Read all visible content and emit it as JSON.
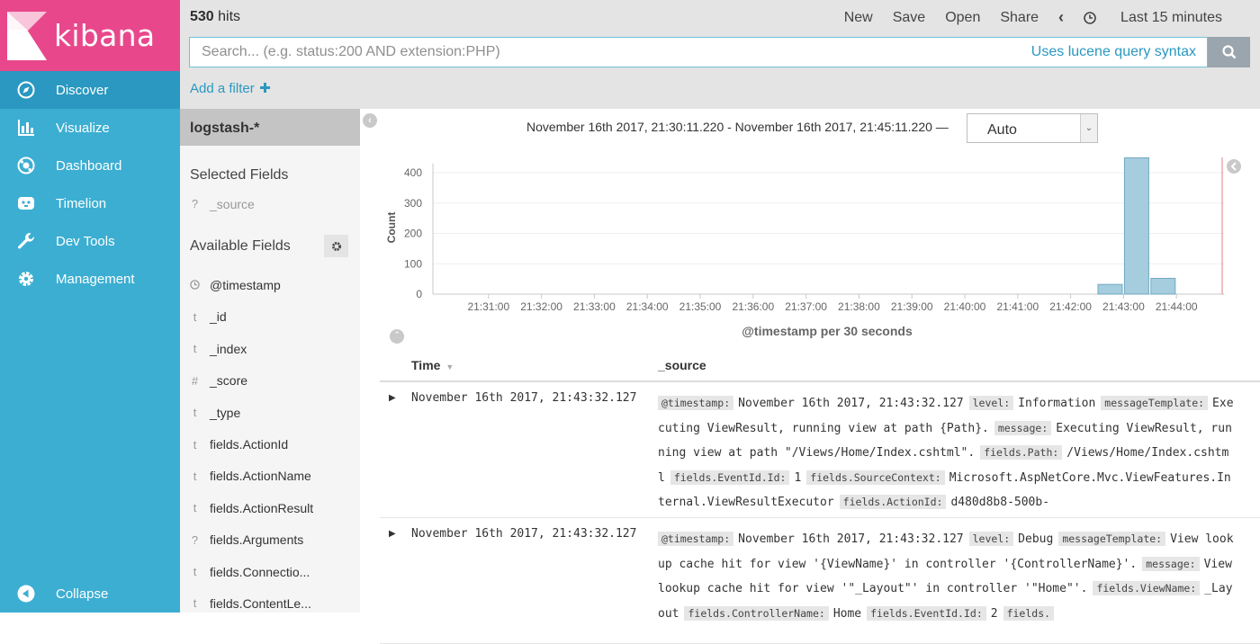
{
  "app": {
    "name": "kibana"
  },
  "nav": {
    "items": [
      {
        "label": "Discover",
        "icon": "compass-icon",
        "active": true
      },
      {
        "label": "Visualize",
        "icon": "bar-chart-icon"
      },
      {
        "label": "Dashboard",
        "icon": "dashboard-icon"
      },
      {
        "label": "Timelion",
        "icon": "timelion-icon"
      },
      {
        "label": "Dev Tools",
        "icon": "wrench-icon"
      },
      {
        "label": "Management",
        "icon": "gear-icon"
      }
    ],
    "collapse": "Collapse"
  },
  "topbar": {
    "hits_count": "530",
    "hits_label": "hits",
    "menu": {
      "new": "New",
      "save": "Save",
      "open": "Open",
      "share": "Share",
      "time": "Last 15 minutes"
    },
    "search": {
      "placeholder": "Search... (e.g. status:200 AND extension:PHP)",
      "hint": "Uses lucene query syntax"
    },
    "add_filter": "Add a filter"
  },
  "sidebar": {
    "index_pattern": "logstash-*",
    "selected_heading": "Selected Fields",
    "selected_fields": [
      {
        "type": "?",
        "name": "_source"
      }
    ],
    "available_heading": "Available Fields",
    "available_fields": [
      {
        "type": "clock",
        "name": "@timestamp"
      },
      {
        "type": "t",
        "name": "_id"
      },
      {
        "type": "t",
        "name": "_index"
      },
      {
        "type": "#",
        "name": "_score"
      },
      {
        "type": "t",
        "name": "_type"
      },
      {
        "type": "t",
        "name": "fields.ActionId"
      },
      {
        "type": "t",
        "name": "fields.ActionName"
      },
      {
        "type": "t",
        "name": "fields.ActionResult"
      },
      {
        "type": "?",
        "name": "fields.Arguments"
      },
      {
        "type": "t",
        "name": "fields.Connectio..."
      },
      {
        "type": "t",
        "name": "fields.ContentLe..."
      }
    ]
  },
  "histogram": {
    "range_text": "November 16th 2017, 21:30:11.220 - November 16th 2017, 21:45:11.220 —",
    "interval": "Auto"
  },
  "chart_data": {
    "type": "bar",
    "ylabel": "Count",
    "xlabel": "@timestamp per 30 seconds",
    "ylim": [
      0,
      450
    ],
    "yticks": [
      0,
      100,
      200,
      300,
      400
    ],
    "xticks": [
      "21:31:00",
      "21:32:00",
      "21:33:00",
      "21:34:00",
      "21:35:00",
      "21:36:00",
      "21:37:00",
      "21:38:00",
      "21:39:00",
      "21:40:00",
      "21:41:00",
      "21:42:00",
      "21:43:00",
      "21:44:00"
    ],
    "bars": [
      {
        "x": "21:42:30",
        "value": 32
      },
      {
        "x": "21:43:00",
        "value": 449
      },
      {
        "x": "21:43:30",
        "value": 52
      }
    ]
  },
  "table": {
    "col_time": "Time",
    "col_source": "_source",
    "rows": [
      {
        "time": "November 16th 2017, 21:43:32.127",
        "fields": [
          {
            "k": "@timestamp:",
            "v": "November 16th 2017, 21:43:32.127"
          },
          {
            "k": "level:",
            "v": "Information"
          },
          {
            "k": "messageTemplate:",
            "v": "Executing ViewResult, running view at path {Path}."
          },
          {
            "k": "message:",
            "v": "Executing ViewResult, running view at path \"/Views/Home/Index.cshtml\"."
          },
          {
            "k": "fields.Path:",
            "v": "/Views/Home/Index.cshtml"
          },
          {
            "k": "fields.EventId.Id:",
            "v": "1"
          },
          {
            "k": "fields.SourceContext:",
            "v": "Microsoft.AspNetCore.Mvc.ViewFeatures.Internal.ViewResultExecutor"
          },
          {
            "k": "fields.ActionId:",
            "v": "d480d8b8-500b-"
          }
        ]
      },
      {
        "time": "November 16th 2017, 21:43:32.127",
        "fields": [
          {
            "k": "@timestamp:",
            "v": "November 16th 2017, 21:43:32.127"
          },
          {
            "k": "level:",
            "v": "Debug"
          },
          {
            "k": "messageTemplate:",
            "v": "View lookup cache hit for view '{ViewName}' in controller '{ControllerName}'."
          },
          {
            "k": "message:",
            "v": "View lookup cache hit for view '\"_Layout\"' in controller '\"Home\"'."
          },
          {
            "k": "fields.ViewName:",
            "v": "_Layout"
          },
          {
            "k": "fields.ControllerName:",
            "v": "Home"
          },
          {
            "k": "fields.EventId.Id:",
            "v": "2"
          },
          {
            "k": "fields.",
            "v": ""
          }
        ]
      }
    ]
  }
}
